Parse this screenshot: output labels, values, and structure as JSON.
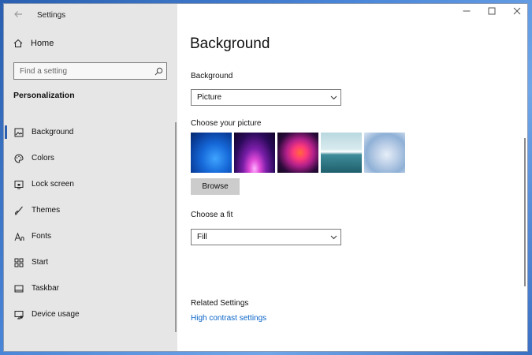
{
  "window": {
    "title": "Settings"
  },
  "sidebar": {
    "home_label": "Home",
    "search_placeholder": "Find a setting",
    "section_title": "Personalization",
    "items": [
      {
        "label": "Background",
        "icon": "picture-icon",
        "active": true
      },
      {
        "label": "Colors",
        "icon": "palette-icon"
      },
      {
        "label": "Lock screen",
        "icon": "lock-screen-icon"
      },
      {
        "label": "Themes",
        "icon": "brush-icon"
      },
      {
        "label": "Fonts",
        "icon": "font-icon"
      },
      {
        "label": "Start",
        "icon": "start-icon"
      },
      {
        "label": "Taskbar",
        "icon": "taskbar-icon"
      },
      {
        "label": "Device usage",
        "icon": "device-usage-icon"
      }
    ]
  },
  "main": {
    "title": "Background",
    "background_label": "Background",
    "background_value": "Picture",
    "choose_picture_label": "Choose your picture",
    "browse_label": "Browse",
    "choose_fit_label": "Choose a fit",
    "fit_value": "Fill",
    "related_title": "Related Settings",
    "related_link": "High contrast settings"
  },
  "colors": {
    "accent": "#2a5fb0",
    "link": "#0a64c8"
  }
}
